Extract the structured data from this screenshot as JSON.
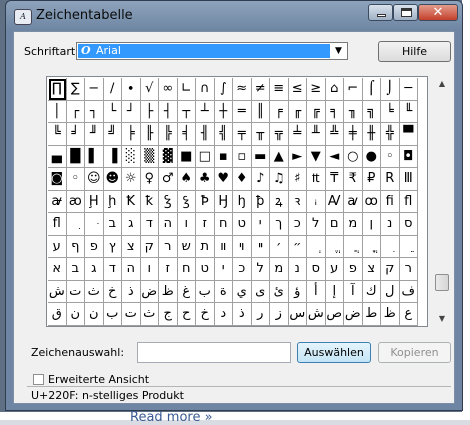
{
  "window": {
    "title": "Zeichentabelle",
    "close_glyph": "✕"
  },
  "font_row": {
    "label": "Schriftart:",
    "selected_font": "Arial",
    "help_button": "Hilfe"
  },
  "characters": [
    [
      "∏",
      "∑",
      "−",
      "∕",
      "∙",
      "√",
      "∞",
      "∟",
      "∩",
      "∫",
      "≈",
      "≠",
      "≡",
      "≤",
      "≥",
      "⌂",
      "⌐",
      "⌠",
      "⌡",
      "─"
    ],
    [
      "│",
      "┌",
      "┐",
      "└",
      "┘",
      "├",
      "┤",
      "┬",
      "┴",
      "┼",
      "═",
      "║",
      "╒",
      "╓",
      "╔",
      "╕",
      "╖",
      "╗",
      "╘",
      "╙"
    ],
    [
      "╚",
      "╛",
      "╜",
      "╝",
      "╞",
      "╟",
      "╠",
      "╡",
      "╢",
      "╣",
      "╤",
      "╥",
      "╦",
      "╧",
      "╨",
      "╩",
      "╪",
      "╫",
      "╬",
      "▀"
    ],
    [
      "▄",
      "█",
      "▌",
      "▐",
      "░",
      "▒",
      "▓",
      "■",
      "□",
      "▪",
      "▫",
      "▬",
      "▲",
      "►",
      "▼",
      "◄",
      "○",
      "●",
      "◦",
      "◘"
    ],
    [
      "◙",
      "◦",
      "☺",
      "☻",
      "☼",
      "♀",
      "♂",
      "♠",
      "♣",
      "♥",
      "♦",
      "♪",
      "♫",
      "♯",
      "₶",
      "₸",
      "₹",
      "₽",
      "R",
      "Ⅲ"
    ],
    [
      "ꜻ",
      "ꜵ",
      "Ḩ",
      "ḩ",
      "Ꝁ",
      "ꝁ",
      "Ꝣ",
      "ꝣ",
      "Ꝥ",
      "Ꜧ",
      "ꜧ",
      "ꝥ",
      "ꝝ",
      "ꝛ",
      "ꜟ",
      "Ꜹ",
      "ꜹ",
      "ꝏ",
      "ﬁ",
      "ﬂ"
    ],
    [
      "ﬂ",
      "ִ",
      "ּ",
      "ב",
      "ג",
      "ד",
      "ה",
      "ו",
      "ז",
      "ח",
      "ט",
      "י",
      "ך",
      "כ",
      "ל",
      "ם",
      "מ",
      "ן",
      "נ",
      "ס"
    ],
    [
      "ע",
      "ף",
      "פ",
      "ץ",
      "צ",
      "ק",
      "ר",
      "ש",
      "ת",
      "װ",
      "ױ",
      "ײ",
      "׳",
      "״",
      "ְ",
      "ֱ",
      "ֲ",
      "ֳ",
      "ִ",
      "ֵ"
    ],
    [
      "א",
      "ב",
      "ג",
      "ד",
      "ה",
      "ו",
      "ז",
      "ח",
      "ט",
      "י",
      "כ",
      "ל",
      "מ",
      "נ",
      "ס",
      "ע",
      "פ",
      "צ",
      "ק",
      "ר"
    ],
    [
      "ش",
      "ت",
      "ث",
      "خ",
      "ذ",
      "ض",
      "ظ",
      "غ",
      "ب",
      "ة",
      "ي",
      "ى",
      "ئ",
      "ؤ",
      "أ",
      "إ",
      "آ",
      "ك",
      "ل",
      "ف"
    ],
    [
      "ق",
      "ن",
      "ن",
      "ب",
      "ت",
      "ث",
      "ج",
      "ح",
      "خ",
      "د",
      "ذ",
      "ر",
      "ز",
      "س",
      "ش",
      "ص",
      "ض",
      "ط",
      "ظ",
      "ع"
    ]
  ],
  "selection": {
    "label": "Zeichenauswahl:",
    "value": "",
    "select_button": "Auswählen",
    "copy_button": "Kopieren"
  },
  "advanced": {
    "label": "Erweiterte Ansicht",
    "checked": false
  },
  "status_text": "U+220F: n-stelliges Produkt",
  "background": {
    "link_text": "Read more »"
  }
}
